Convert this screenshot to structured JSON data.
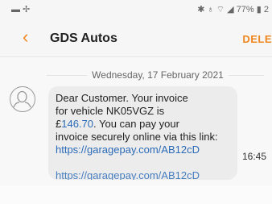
{
  "status": {
    "left_icons": "▬ ✢",
    "right_text": "✱ ♁ ⌔ ◢ 77% ▮ 2"
  },
  "header": {
    "back_glyph": "‹",
    "title": "GDS Autos",
    "delete_label": "DELE"
  },
  "conversation": {
    "date": "Wednesday, 17 February 2021",
    "message_lines": [
      "Dear Customer. Your invoice",
      "for vehicle NK05VGZ is",
      "£146.70. You can pay your",
      "invoice securely online via this link:",
      "https://garagepay.com/AB12cD"
    ],
    "currency": "£",
    "amount": "146.70",
    "amount_suffix": ". You can pay your",
    "ghost_link": "https://garagepay.com/AB12cD",
    "time": "16:45"
  },
  "colors": {
    "accent": "#f0861e",
    "link": "#2a6ab8"
  }
}
